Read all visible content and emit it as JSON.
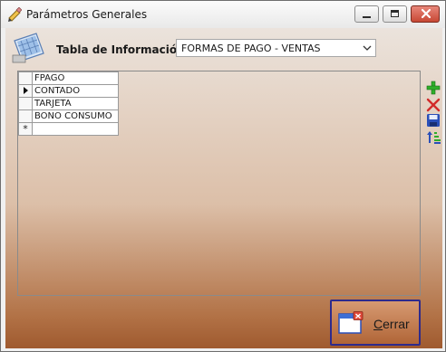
{
  "window": {
    "title": "Parámetros Generales"
  },
  "form": {
    "table_label": "Tabla de Información:",
    "table_select": {
      "selected": "FORMAS DE PAGO - VENTAS"
    }
  },
  "grid": {
    "columns": [
      "FPAGO"
    ],
    "rows": [
      "CONTADO",
      "TARJETA",
      "BONO CONSUMO"
    ],
    "new_row_marker": "*"
  },
  "toolbar": {
    "icons": [
      "add-icon",
      "delete-icon",
      "save-icon",
      "sort-icon"
    ]
  },
  "footer": {
    "close_button": {
      "mnemonic": "C",
      "rest": "errar"
    }
  },
  "colors": {
    "add": "#2fae2a",
    "delete": "#d22b2b",
    "save": "#2a4fb8",
    "button_border": "#2e2a8c"
  }
}
